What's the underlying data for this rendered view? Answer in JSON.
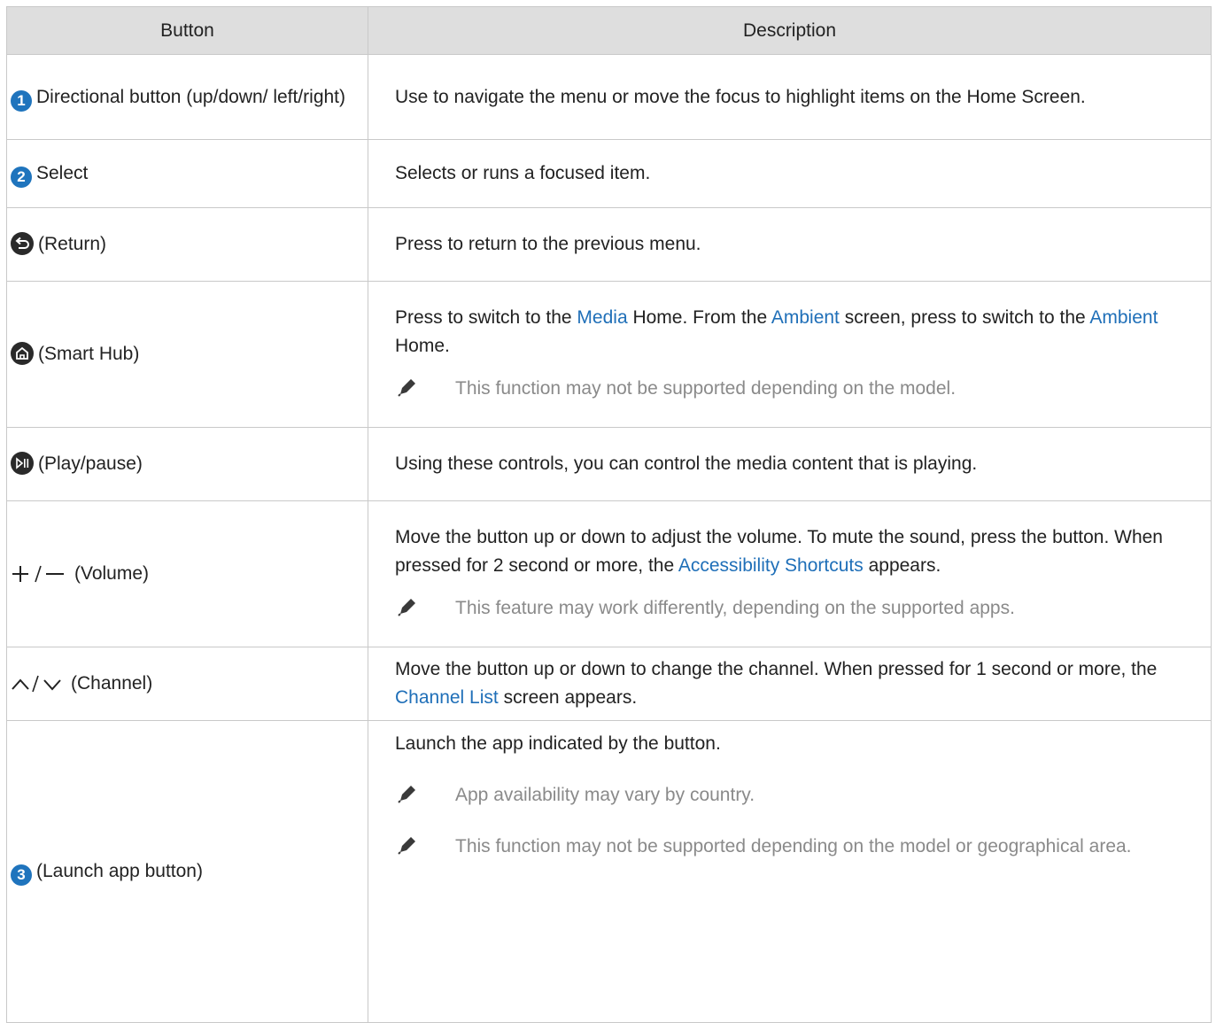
{
  "table": {
    "headers": {
      "button": "Button",
      "description": "Description"
    },
    "rows": [
      {
        "num": "1",
        "label": "Directional button (up/down/ left/right)",
        "desc": "Use to navigate the menu or move the focus to highlight items on the Home Screen."
      },
      {
        "num": "2",
        "label": "Select",
        "desc": "Selects or runs a focused item."
      },
      {
        "icon": "return-icon",
        "label": "(Return)",
        "desc": "Press to return to the previous menu."
      },
      {
        "icon": "home-icon",
        "label": "(Smart Hub)",
        "desc_parts": [
          "Press to switch to the ",
          "Media",
          " Home. From the ",
          "Ambient",
          " screen, press to switch to the ",
          "Ambient",
          " Home."
        ],
        "note": "This function may not be supported depending on the model."
      },
      {
        "icon": "play-pause-icon",
        "label": "(Play/pause)",
        "desc": "Using these controls, you can control the media content that is playing."
      },
      {
        "icon": "volume-icon",
        "label": "(Volume)",
        "desc_parts": [
          "Move the button up or down to adjust the volume. To mute the sound, press the button. When pressed for 2 second or more, the ",
          "Accessibility Shortcuts",
          " appears."
        ],
        "note": "This feature may work differently, depending on the supported apps."
      },
      {
        "icon": "channel-icon",
        "label": "(Channel)",
        "desc_parts": [
          "Move the button up or down to change the channel. When pressed for 1 second or more, the  ",
          "Channel List",
          " screen appears."
        ]
      },
      {
        "num": "3",
        "label": "(Launch app button)",
        "desc": "Launch the app indicated by the button.",
        "notes": [
          "App availability may vary by country.",
          "This function may not be supported depending on the model or geographical area."
        ]
      }
    ]
  },
  "colors": {
    "highlight": "#1f6fb8",
    "badge": "#1f74bd",
    "header_bg": "#dedede",
    "note_text": "#8a8a8a"
  }
}
